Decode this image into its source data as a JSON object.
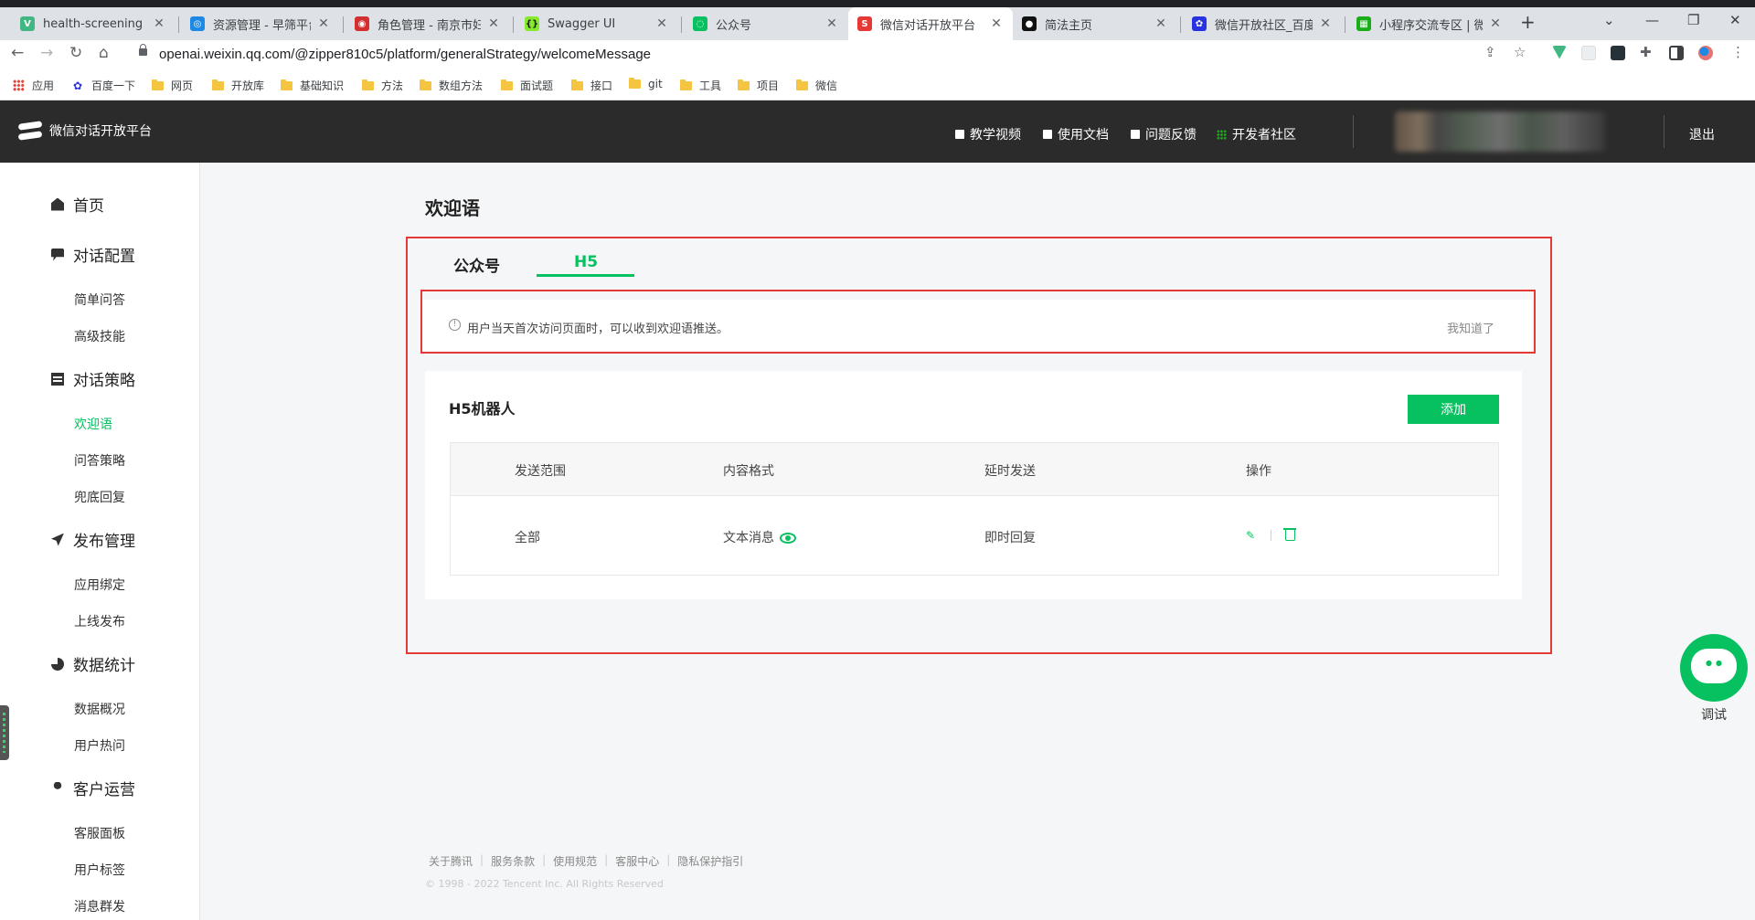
{
  "browser": {
    "tabs": [
      {
        "title": "health-screening",
        "favicon_color": "#41b883",
        "favicon_glyph": "V"
      },
      {
        "title": "资源管理 - 早筛平台",
        "favicon_color": "#1e88e5",
        "favicon_glyph": "◎"
      },
      {
        "title": "角色管理 - 南京市妇幼",
        "favicon_color": "#d32f2f",
        "favicon_glyph": "◉"
      },
      {
        "title": "Swagger UI",
        "favicon_color": "#85ea2d",
        "favicon_glyph": "{}"
      },
      {
        "title": "公众号",
        "favicon_color": "#07c160",
        "favicon_glyph": "◌"
      },
      {
        "title": "微信对话开放平台",
        "favicon_color": "#e53935",
        "favicon_glyph": "S",
        "active": true
      },
      {
        "title": "简法主页",
        "favicon_color": "#111111",
        "favicon_glyph": "●"
      },
      {
        "title": "微信开放社区_百度搜",
        "favicon_color": "#2932e1",
        "favicon_glyph": "✿"
      },
      {
        "title": "小程序交流专区 | 微信",
        "favicon_color": "#1aad19",
        "favicon_glyph": "▦"
      }
    ],
    "url": "openai.weixin.qq.com/@zipper810c5/platform/generalStrategy/welcomeMessage",
    "bookmarks": [
      "应用",
      "百度一下",
      "网页",
      "开放库",
      "基础知识",
      "方法",
      "数组方法",
      "面试题",
      "接口",
      "git",
      "工具",
      "项目",
      "微信"
    ]
  },
  "header": {
    "logo_text": "微信对话开放平台",
    "nav": [
      "教学视频",
      "使用文档",
      "问题反馈",
      "开发者社区"
    ],
    "logout": "退出"
  },
  "sidebar": {
    "groups": [
      {
        "label": "首页",
        "icon": "home-icon",
        "items": []
      },
      {
        "label": "对话配置",
        "icon": "chat-icon",
        "items": [
          "简单问答",
          "高级技能"
        ]
      },
      {
        "label": "对话策略",
        "icon": "strategy-icon",
        "items": [
          "欢迎语",
          "问答策略",
          "兜底回复"
        ]
      },
      {
        "label": "发布管理",
        "icon": "send-icon",
        "items": [
          "应用绑定",
          "上线发布"
        ]
      },
      {
        "label": "数据统计",
        "icon": "pie-chart-icon",
        "items": [
          "数据概况",
          "用户热问"
        ]
      },
      {
        "label": "客户运营",
        "icon": "user-icon",
        "items": [
          "客服面板",
          "用户标签",
          "消息群发"
        ]
      }
    ],
    "active_item": "欢迎语"
  },
  "main": {
    "title": "欢迎语",
    "tabs": [
      "公众号",
      "H5"
    ],
    "active_tab": "H5",
    "notice": {
      "text": "用户当天首次访问页面时，可以收到欢迎语推送。",
      "dismiss": "我知道了"
    },
    "card": {
      "title": "H5机器人",
      "add_button": "添加",
      "columns": [
        "发送范围",
        "内容格式",
        "延时发送",
        "操作"
      ],
      "rows": [
        {
          "scope": "全部",
          "format": "文本消息",
          "delay": "即时回复"
        }
      ]
    },
    "footer": {
      "links": [
        "关于腾讯",
        "服务条款",
        "使用规范",
        "客服中心",
        "隐私保护指引"
      ],
      "copyright": "© 1998 - 2022 Tencent Inc. All Rights Reserved"
    },
    "bot_label": "调试"
  },
  "colors": {
    "accent": "#07c160",
    "header_bg": "#2b2b2b",
    "highlight_border": "#e53935"
  }
}
